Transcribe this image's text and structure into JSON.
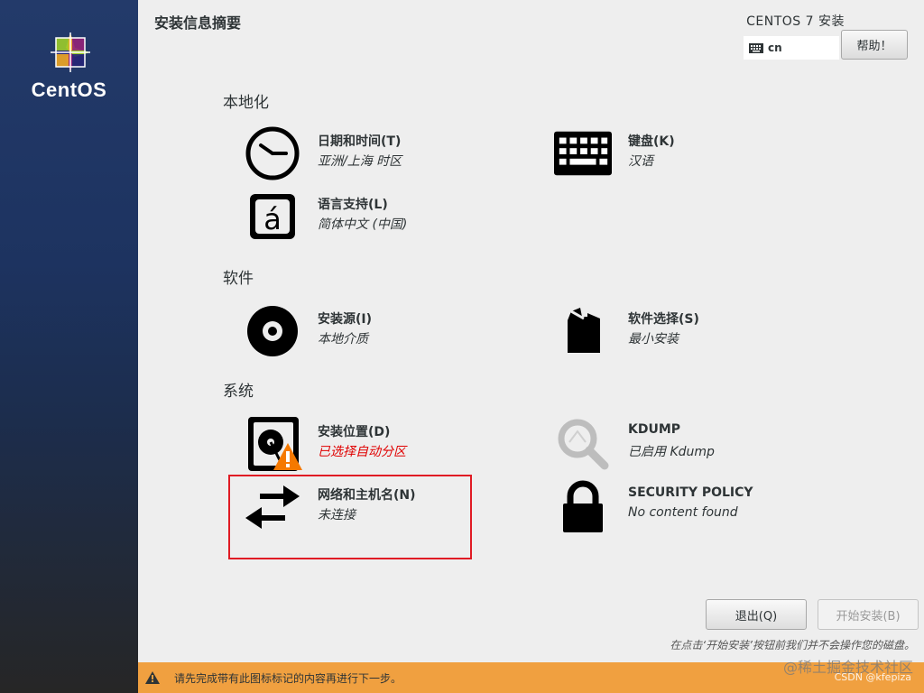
{
  "sidebar": {
    "brand": "CentOS"
  },
  "header": {
    "title": "安装信息摘要",
    "product": "CENTOS 7 安装",
    "keyboard_layout": "cn",
    "help_label": "帮助！"
  },
  "sections": {
    "localization": "本地化",
    "software": "软件",
    "system": "系统"
  },
  "spokes": {
    "datetime": {
      "title": "日期和时间(T)",
      "status": "亚洲/上海 时区"
    },
    "keyboard": {
      "title": "键盘(K)",
      "status": "汉语"
    },
    "language": {
      "title": "语言支持(L)",
      "status": "简体中文 (中国)"
    },
    "source": {
      "title": "安装源(I)",
      "status": "本地介质"
    },
    "software": {
      "title": "软件选择(S)",
      "status": "最小安装"
    },
    "destination": {
      "title": "安装位置(D)",
      "status": "已选择自动分区"
    },
    "kdump": {
      "title": "KDUMP",
      "status": "已启用 Kdump"
    },
    "network": {
      "title": "网络和主机名(N)",
      "status": "未连接"
    },
    "security": {
      "title": "SECURITY POLICY",
      "status": "No content found"
    }
  },
  "footer": {
    "quit_label": "退出(Q)",
    "begin_label": "开始安装(B)",
    "note": "在点击‘开始安装’按钮前我们并不会操作您的磁盘。",
    "warning": "请先完成带有此图标标记的内容再进行下一步。"
  },
  "watermark": {
    "line1": "@稀土掘金技术社区",
    "line2": "CSDN @kfepiza"
  },
  "colors": {
    "warning_bar": "#f0a040",
    "error_text": "#e00000",
    "highlight_box": "#e01b24",
    "warning_icon": "#f57900"
  },
  "icons": {
    "datetime": "clock-icon",
    "keyboard": "keyboard-icon",
    "language": "language-icon",
    "source": "disc-icon",
    "software": "package-icon",
    "destination": "harddisk-icon",
    "kdump": "magnifier-icon",
    "network": "network-arrows-icon",
    "security": "lock-icon"
  }
}
